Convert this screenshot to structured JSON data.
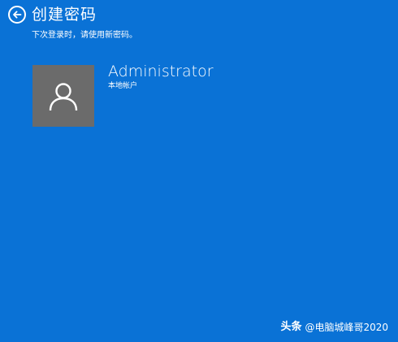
{
  "header": {
    "title": "创建密码",
    "back_icon": "back-arrow-icon"
  },
  "subtitle": "下次登录时，请使用新密码。",
  "account": {
    "name": "Administrator",
    "type": "本地帐户",
    "avatar_icon": "user-avatar-icon"
  },
  "watermark": {
    "brand": "头条",
    "handle": "@电脑城峰哥2020"
  },
  "colors": {
    "background": "#0a72d6",
    "avatar_tile": "#6b6b6b",
    "text": "#ffffff"
  }
}
